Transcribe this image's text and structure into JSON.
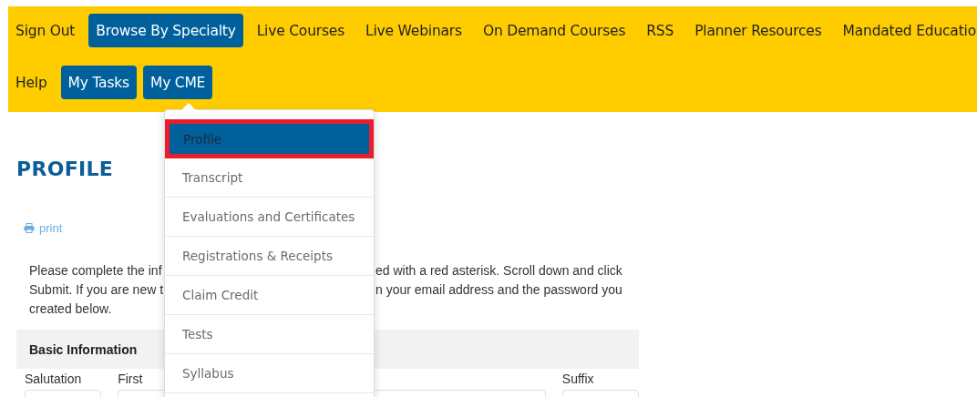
{
  "nav_rows": [
    [
      {
        "label": "Sign Out",
        "selected": false
      },
      {
        "label": "Browse By Specialty",
        "selected": true
      },
      {
        "label": "Live Courses",
        "selected": false
      },
      {
        "label": "Live Webinars",
        "selected": false
      },
      {
        "label": "On Demand Courses",
        "selected": false
      },
      {
        "label": "RSS",
        "selected": false
      },
      {
        "label": "Planner Resources",
        "selected": false
      },
      {
        "label": "Mandated Educatio",
        "selected": false
      }
    ],
    [
      {
        "label": "Help",
        "selected": false
      },
      {
        "label": "My Tasks",
        "selected": true
      },
      {
        "label": "My CME",
        "selected": true
      }
    ]
  ],
  "dropdown": {
    "items": [
      {
        "label": "Profile",
        "selected": true,
        "outlined": true
      },
      {
        "label": "Transcript",
        "selected": false,
        "outlined": false
      },
      {
        "label": "Evaluations and Certificates",
        "selected": false,
        "outlined": false
      },
      {
        "label": "Registrations & Receipts",
        "selected": false,
        "outlined": false
      },
      {
        "label": "Claim Credit",
        "selected": false,
        "outlined": false
      },
      {
        "label": "Tests",
        "selected": false,
        "outlined": false
      },
      {
        "label": "Syllabus",
        "selected": false,
        "outlined": false
      }
    ]
  },
  "page": {
    "title": "PROFILE",
    "print_link": "print",
    "intro_lines": [
      {
        "left": "Please complete the inf",
        "right": "ed with a red asterisk. Scroll down and click"
      },
      {
        "left": "Submit. If you are new t",
        "right": "n your email address and the password you"
      },
      {
        "left": "created below."
      }
    ],
    "section_title": "Basic Information",
    "fields": [
      {
        "kind": "labeled",
        "label": "Salutation"
      },
      {
        "kind": "labeled",
        "label": "First"
      },
      {
        "kind": "unlabeled"
      },
      {
        "kind": "labeled",
        "label": "Suffix"
      }
    ]
  }
}
